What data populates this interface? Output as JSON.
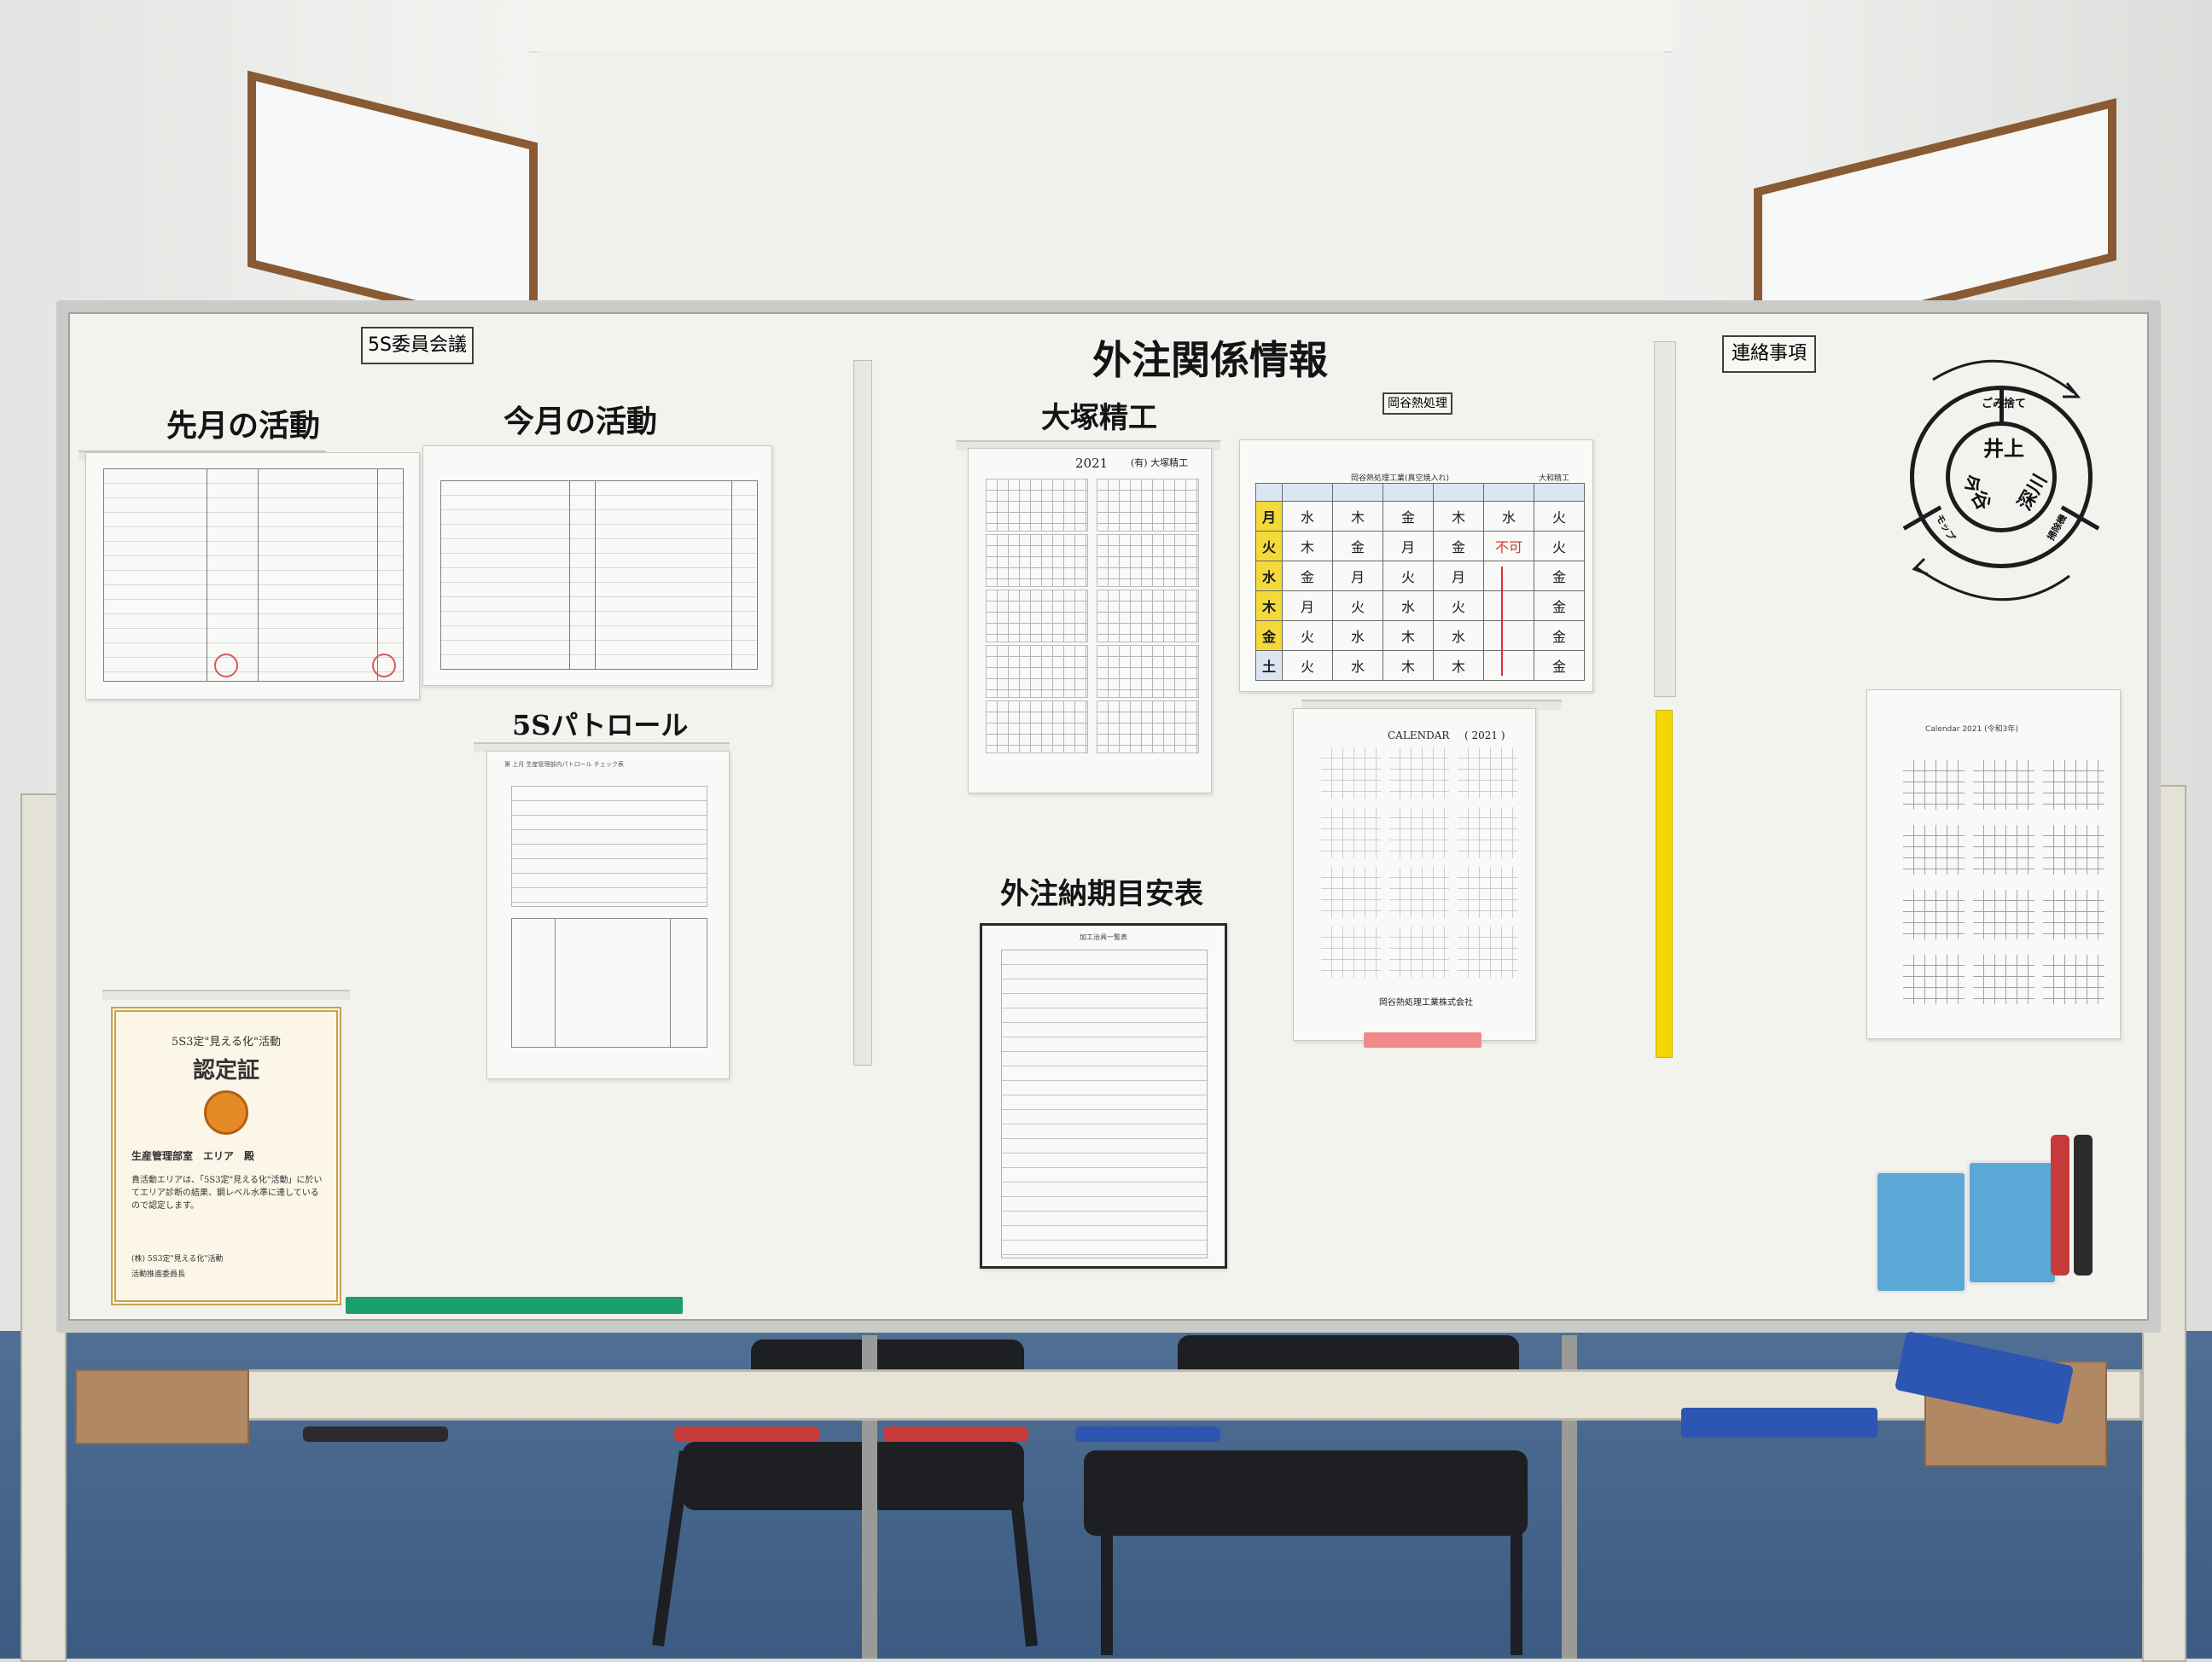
{
  "board": {
    "sections": {
      "committee_label": "5S委員会議",
      "contact_label": "連絡事項",
      "title_main": "外注関係情報",
      "last_month": "先月の活動",
      "this_month": "今月の活動",
      "patrol": "5Sパトロール",
      "otsuka": "大塚精工",
      "delivery_table": "外注納期目安表",
      "okaya_label": "岡谷熱処理"
    },
    "otsuka_calendar": {
      "year": "2021",
      "company": "(有) 大塚精工"
    },
    "okaya_schedule": {
      "title": "岡谷熱処理工業(真空焼入れ)",
      "vendor": "大和精工",
      "rows": [
        {
          "day": "月",
          "cells": [
            "水",
            "木",
            "金",
            "木",
            "水",
            "火"
          ]
        },
        {
          "day": "火",
          "cells": [
            "木",
            "金",
            "月",
            "金",
            "不可",
            "火"
          ]
        },
        {
          "day": "水",
          "cells": [
            "金",
            "月",
            "火",
            "月",
            "",
            "金"
          ]
        },
        {
          "day": "木",
          "cells": [
            "月",
            "火",
            "水",
            "火",
            "",
            "金"
          ]
        },
        {
          "day": "金",
          "cells": [
            "火",
            "水",
            "木",
            "水",
            "",
            "金"
          ]
        },
        {
          "day": "土",
          "cells": [
            "火",
            "水",
            "木",
            "木",
            "",
            "金"
          ]
        }
      ]
    },
    "okaya_calendar": {
      "title": "CALENDAR",
      "year": "( 2021 )",
      "company": "岡谷熱処理工業株式会社"
    },
    "right_calendar": {
      "title": "Calendar 2021 (令和3年)"
    },
    "wheel": {
      "top": "ごみ捨て",
      "center_top": "井上",
      "center_left": "今谷",
      "center_right": "深川",
      "left": "モップ",
      "right": "掃除機"
    },
    "certificate": {
      "heading": "5S3定\"見える化\"活動",
      "title": "認定証",
      "recipient": "生産管理部室　エリア　殿",
      "body": "貴活動エリアは、「5S3定\"見える化\"活動」に於いてエリア診断の結果、鋼レベル水準に達しているので認定します。",
      "issuer": "(株) 5S3定\"見える化\"活動",
      "signer": "活動推進委員長"
    },
    "delivery_sheet_title": "加工治具一覧表",
    "patrol_sheet_title": "第 上月 生産管理部内パトロール チェック表"
  },
  "colors": {
    "yellow_tape": "#f1d800",
    "green_ruler": "#1a9f6b",
    "day_yellow": "#f4d93a",
    "frame_wood": "#8a5a34",
    "floor_blue": "#46658c"
  }
}
